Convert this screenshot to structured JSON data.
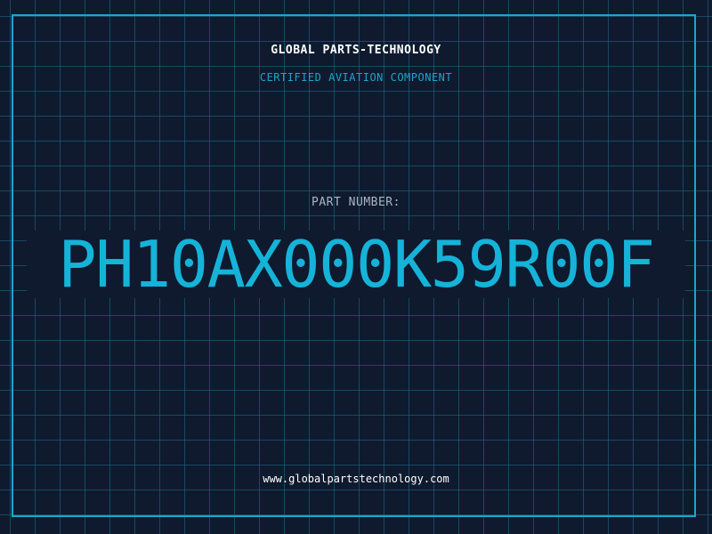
{
  "header": {
    "company": "GLOBAL PARTS-TECHNOLOGY",
    "subtitle": "CERTIFIED AVIATION COMPONENT"
  },
  "part": {
    "label": "PART NUMBER:",
    "number": "PH10AX000K59R00F"
  },
  "footer": {
    "url": "www.globalpartstechnology.com"
  },
  "colors": {
    "background": "#0f1a2e",
    "accent": "#1ba6cc",
    "part_number": "#16b3d9",
    "label": "#a9b6c6",
    "text": "#ffffff"
  }
}
